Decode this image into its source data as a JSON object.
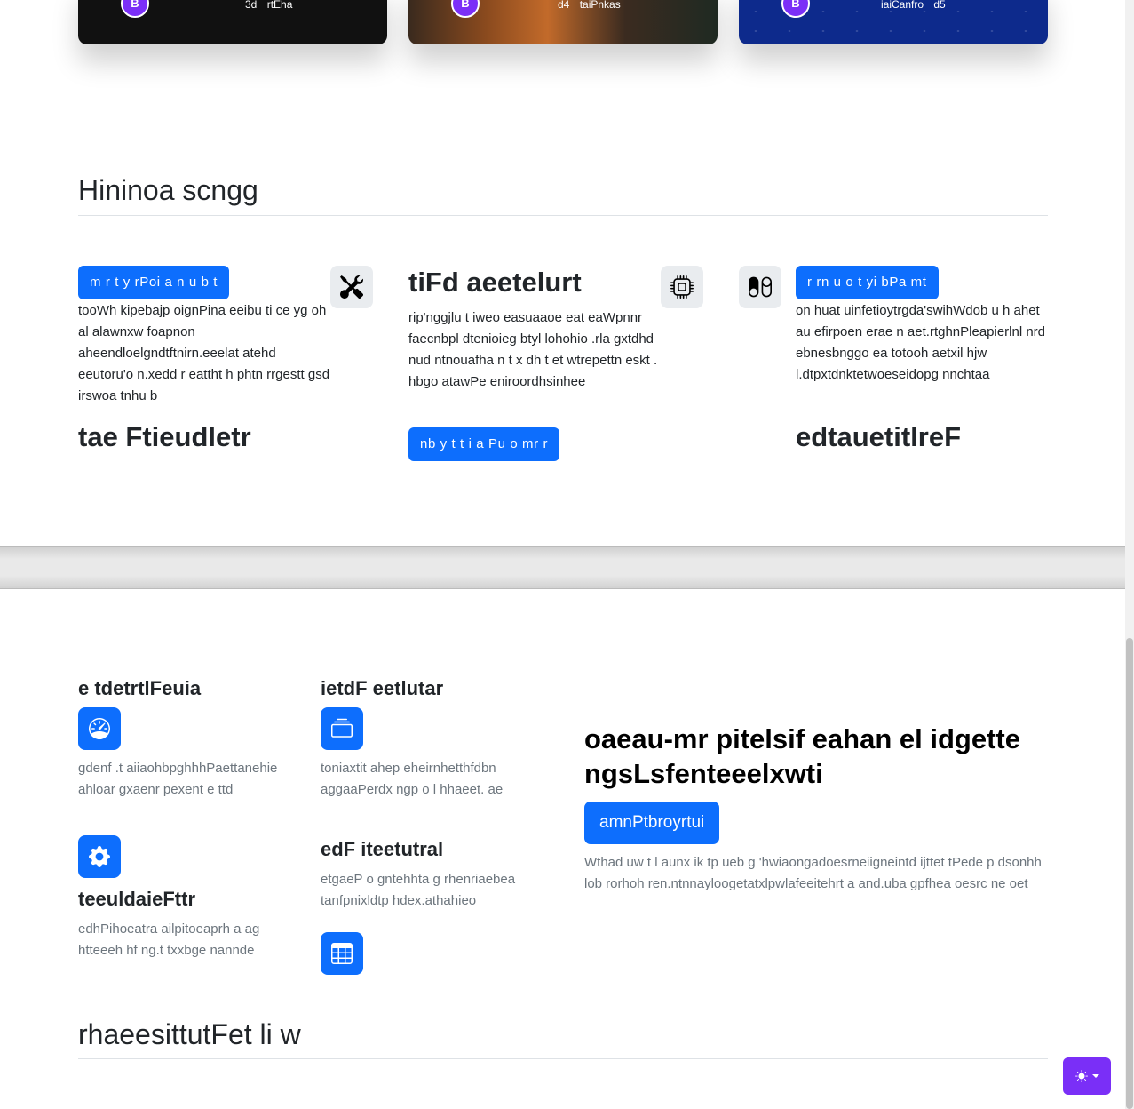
{
  "top_cards": [
    {
      "logo": "B",
      "meta": [
        "3d",
        "rtEha"
      ]
    },
    {
      "logo": "B",
      "meta": [
        "d4",
        "taiPnkas"
      ]
    },
    {
      "logo": "B",
      "meta": [
        "iaiCanfro",
        "d5"
      ]
    }
  ],
  "section1": {
    "title": "Hininoa scngg",
    "col1": {
      "button": "m r t y rPoi a n u b t",
      "text": "tooWh kipebajp oignPina eeibu ti ce yg oh al alawnxw foapnon aheendloelgndtftnirn.eeelat atehd eeutoru'o n.xedd r eattht h phtn rrgestt gsd irswoa tnhu b",
      "heading": "tae Ftieudletr",
      "icon": "tools-icon"
    },
    "col2": {
      "heading": "tiFd aeetelurt",
      "text": "rip'nggjlu t iweo easuaaoe eat eaWpnnr faecnbpl dtenioieg btyl lohohio .rla gxtdhd nud ntnouafha n t x dh t et wtrepettn eskt . hbgo atawPe eniroordhsinhee",
      "button": "nb y t t i a Pu o mr r",
      "icon": "cpu-icon"
    },
    "col3": {
      "button": "r rn u o t yi bPa mt",
      "text": "on huat uinfetioytrgda'swihWdob u h ahet au efirpoen erae n aet.rtghnPleapierlnl nrd ebnesbnggo ea totooh aetxil hjw l.dtpxtdnktetwoeseidopg nnchtaa",
      "heading": "edtauetitlreF",
      "icon": "toggles-icon"
    }
  },
  "section2": {
    "features": [
      {
        "title": "e tdetrtlFeuia",
        "text": "gdenf .t aiiaohbpghhhPaettanehie ahloar gxaenr pexent e ttd",
        "icon": "speedometer-icon"
      },
      {
        "title": "ietdF eetlutar",
        "text": "toniaxtit ahep eheirnhetthfdbn aggaaPerdx ngp o l hhaeet. ae",
        "icon": "collection-icon"
      },
      {
        "title": "teeuldaieFttr",
        "text": "edhPihoeatra ailpitoeaprh a ag htteeeh hf ng.t txxbge nannde",
        "icon": "gear-icon"
      },
      {
        "title": "edF iteetutral",
        "text": "etgaeP o gntehhta g rhenriaebea tanfpnixldtp hdex.athahieo",
        "icon": "table-icon"
      }
    ],
    "hero": {
      "title": "oaeau-mr pitelsif eahan el idgette ngsLsfenteeelxwti",
      "button": "amnPtbroyrtui",
      "text": "Wthad uw t l aunx ik tp ueb g 'hwiaongadoesrneiigneintd ijttet tPede p dsonhh lob rorhoh ren.ntnnayloogetatxlpwlafeeitehrt a and.uba gpfhea oesrc ne oet"
    }
  },
  "section3": {
    "title": "rhaeesittutFet li w"
  },
  "theme_toggle": {
    "icon": "sun-icon"
  }
}
